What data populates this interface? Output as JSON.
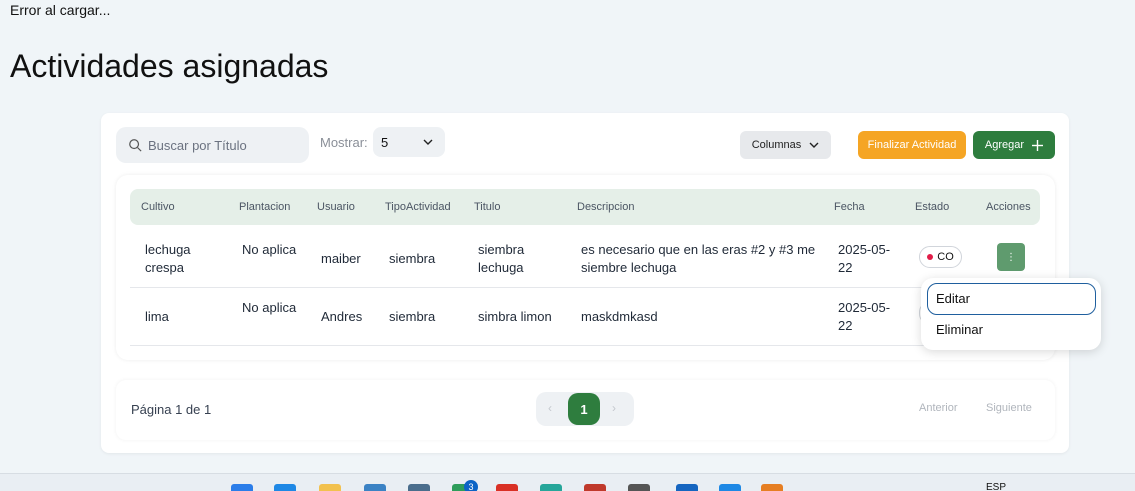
{
  "error_text": "Error al cargar...",
  "page_title": "Actividades asignadas",
  "toolbar": {
    "search_placeholder": "Buscar por Título",
    "show_label": "Mostrar:",
    "show_value": "5",
    "columns_label": "Columnas",
    "finish_label": "Finalizar Actividad",
    "add_label": "Agregar"
  },
  "table": {
    "headers": [
      "Cultivo",
      "Plantacion",
      "Usuario",
      "TipoActividad",
      "Titulo",
      "Descripcion",
      "Fecha",
      "Estado",
      "Acciones"
    ],
    "rows": [
      {
        "cultivo": "lechuga crespa",
        "plantacion": "No aplica",
        "usuario": "maiber",
        "tipo": "siembra",
        "titulo": "siembra lechuga",
        "descripcion": "es necesario que en las eras #2 y #3 me siembre lechuga",
        "fecha": "2025-05-22",
        "estado": "CO"
      },
      {
        "cultivo": "lima",
        "plantacion": "No aplica",
        "usuario": "Andres",
        "tipo": "siembra",
        "titulo": "simbra limon",
        "descripcion": "maskdmkasd",
        "fecha": "2025-05-22",
        "estado": ""
      }
    ]
  },
  "pagination": {
    "info": "Página 1 de 1",
    "current": "1",
    "prev_label": "Anterior",
    "next_label": "Siguiente"
  },
  "menu": {
    "edit": "Editar",
    "delete": "Eliminar"
  },
  "taskbar": {
    "language": "ESP",
    "badge_count": "3"
  },
  "colors": {
    "primary": "#2e7d3e",
    "warning": "#f5a524",
    "header_bg": "#e5efe8",
    "status_dot": "#e11d48"
  }
}
